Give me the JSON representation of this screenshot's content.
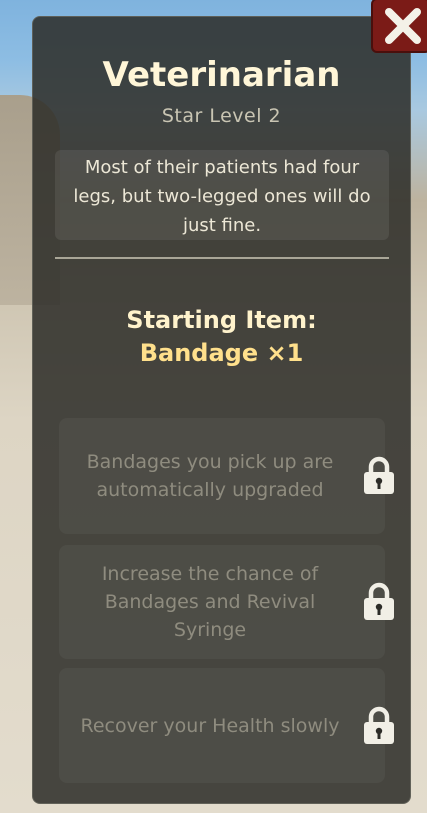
{
  "title": "Veterinarian",
  "subtitle": "Star Level 2",
  "description": "Most of their patients had four legs, but two-legged ones will do just fine.",
  "starting_item": {
    "label": "Starting Item:",
    "value": "Bandage ×1"
  },
  "perks": [
    {
      "text": "Bandages you pick up are automatically upgraded",
      "locked": true
    },
    {
      "text": "Increase the chance of Bandages and Revival Syringe",
      "locked": true
    },
    {
      "text": "Recover your Health slowly",
      "locked": true
    }
  ],
  "icons": {
    "close": "close-icon",
    "lock": "lock-icon"
  },
  "colors": {
    "title": "#fff6d8",
    "starting_value": "#ffe08c",
    "close_button": "#7b1b17",
    "perk_text": "#8f8c7f"
  }
}
